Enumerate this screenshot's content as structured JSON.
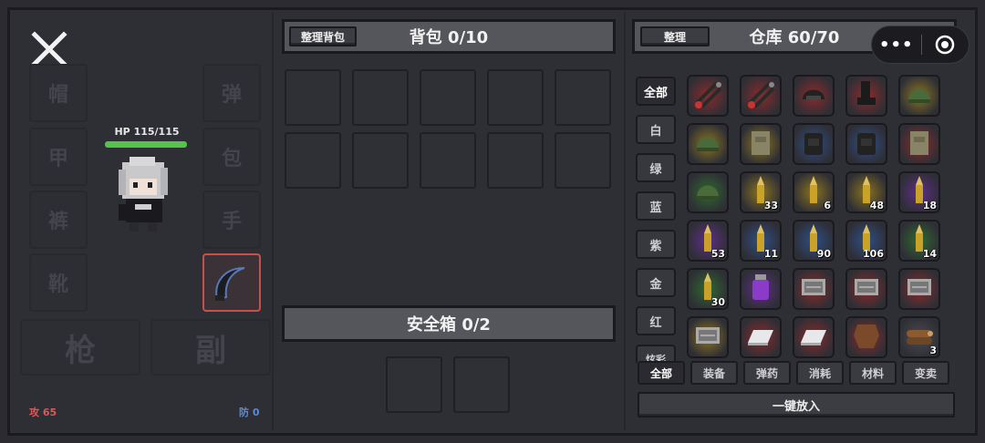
{
  "left": {
    "close_glyph": "✕",
    "hp_text": "HP 115/115",
    "hp_fraction": 1.0,
    "equip_slots": [
      "帽",
      "甲",
      "裤",
      "靴",
      "弹",
      "包",
      "手"
    ],
    "weapon_slots": [
      "枪",
      "副"
    ],
    "attack": "攻 65",
    "defense": "防 0"
  },
  "backpack": {
    "sort_label": "整理背包",
    "title": "背包 0/10"
  },
  "safebox": {
    "title": "安全箱 0/2"
  },
  "warehouse": {
    "sort_label": "整理",
    "title": "仓库 60/70",
    "rarity_filters": [
      "全部",
      "白",
      "绿",
      "蓝",
      "紫",
      "金",
      "红",
      "炫彩"
    ],
    "category_tabs": [
      "全部",
      "装备",
      "弹药",
      "消耗",
      "材料",
      "变卖"
    ],
    "put_all_label": "一键放入",
    "items": [
      {
        "icon": "wire-cutter-icon",
        "rarity": "red",
        "count": ""
      },
      {
        "icon": "wire-cutter-icon",
        "rarity": "red",
        "count": ""
      },
      {
        "icon": "tactical-helmet-icon",
        "rarity": "red",
        "count": ""
      },
      {
        "icon": "combat-boots-icon",
        "rarity": "red",
        "count": ""
      },
      {
        "icon": "helmet-icon",
        "rarity": "gold",
        "count": ""
      },
      {
        "icon": "helmet-icon",
        "rarity": "gold",
        "count": ""
      },
      {
        "icon": "vest-icon",
        "rarity": "gold",
        "count": ""
      },
      {
        "icon": "backpack-icon",
        "rarity": "blue",
        "count": ""
      },
      {
        "icon": "backpack-icon",
        "rarity": "blue",
        "count": ""
      },
      {
        "icon": "vest-icon",
        "rarity": "red",
        "count": ""
      },
      {
        "icon": "helmet-icon",
        "rarity": "green",
        "count": ""
      },
      {
        "icon": "bullet-icon",
        "rarity": "gold",
        "count": "33"
      },
      {
        "icon": "bullet-icon",
        "rarity": "gold",
        "count": "6"
      },
      {
        "icon": "bullet-icon",
        "rarity": "gold",
        "count": "48"
      },
      {
        "icon": "bullet-icon",
        "rarity": "purple",
        "count": "18"
      },
      {
        "icon": "bullet-icon",
        "rarity": "purple",
        "count": "53"
      },
      {
        "icon": "bullet-icon",
        "rarity": "blue",
        "count": "11"
      },
      {
        "icon": "bullet-icon",
        "rarity": "blue",
        "count": "90"
      },
      {
        "icon": "bullet-icon",
        "rarity": "blue",
        "count": "106"
      },
      {
        "icon": "bullet-icon",
        "rarity": "green",
        "count": "14"
      },
      {
        "icon": "bullet-icon",
        "rarity": "green",
        "count": "30"
      },
      {
        "icon": "potion-jar-icon",
        "rarity": "purple",
        "count": ""
      },
      {
        "icon": "circuit-board-icon",
        "rarity": "red",
        "count": ""
      },
      {
        "icon": "circuit-board-icon",
        "rarity": "red",
        "count": ""
      },
      {
        "icon": "circuit-board-icon",
        "rarity": "red",
        "count": ""
      },
      {
        "icon": "circuit-board-icon",
        "rarity": "gold",
        "count": ""
      },
      {
        "icon": "silver-bar-icon",
        "rarity": "red",
        "count": ""
      },
      {
        "icon": "silver-bar-icon",
        "rarity": "red",
        "count": ""
      },
      {
        "icon": "leather-icon",
        "rarity": "red",
        "count": ""
      },
      {
        "icon": "wood-logs-icon",
        "rarity": "gray",
        "count": "3"
      }
    ]
  },
  "colors": {
    "red": "#8a2b2b",
    "gold": "#8a7420",
    "blue": "#2f4f86",
    "purple": "#5e2f86",
    "green": "#2f6a2f",
    "gray": "#4a4a50",
    "hp": "#55c24b",
    "attack": "#d85a5a",
    "defense": "#5a8ad8"
  }
}
